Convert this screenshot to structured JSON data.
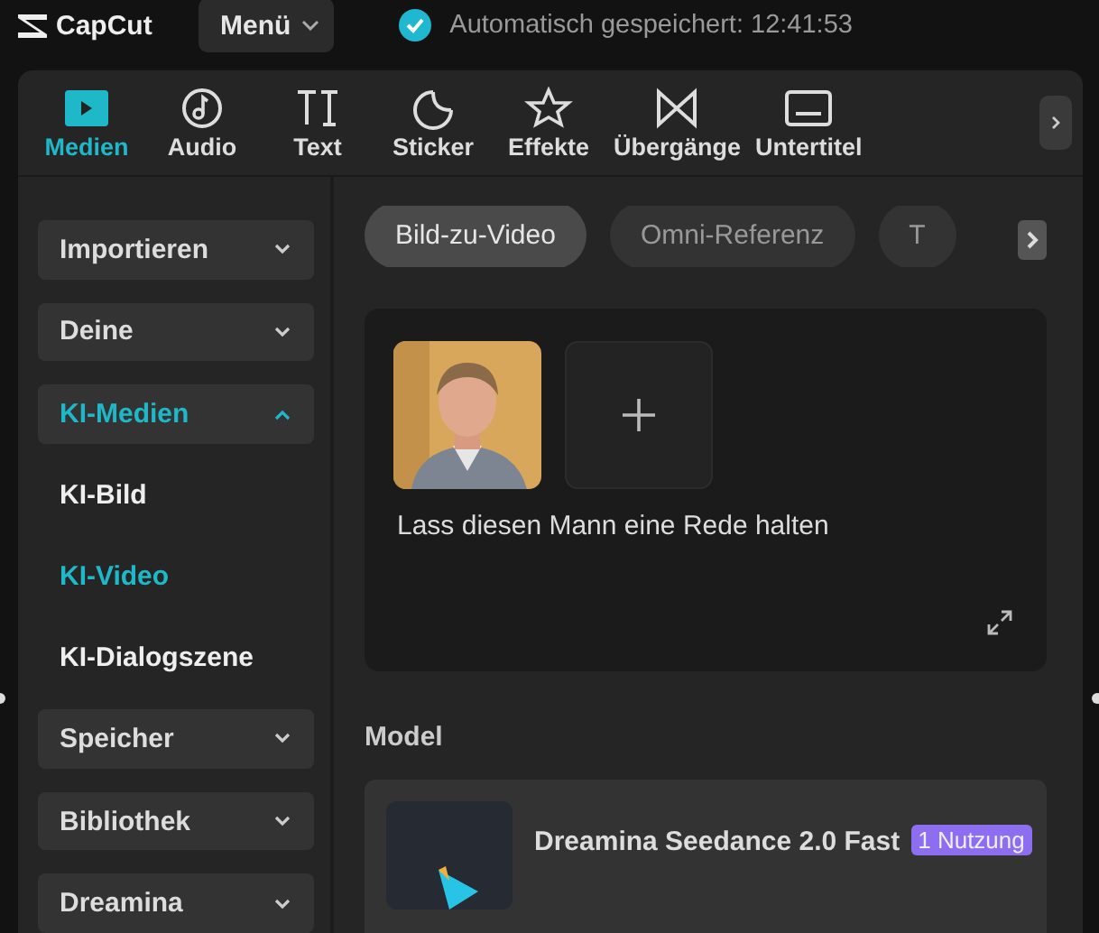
{
  "app": {
    "logo": "CapCut",
    "menu": "Menü",
    "autosave": "Automatisch gespeichert: 12:41:53"
  },
  "tabs": [
    {
      "label": "Medien",
      "kind": "media",
      "selected": true
    },
    {
      "label": "Audio",
      "kind": "audio",
      "selected": false
    },
    {
      "label": "Text",
      "kind": "text",
      "selected": false
    },
    {
      "label": "Sticker",
      "kind": "sticker",
      "selected": false
    },
    {
      "label": "Effekte",
      "kind": "effects",
      "selected": false
    },
    {
      "label": "Übergänge",
      "kind": "transitions",
      "selected": false
    },
    {
      "label": "Untertitel",
      "kind": "subtitles",
      "selected": false
    }
  ],
  "sidebar": [
    {
      "label": "Importieren",
      "kind": "group",
      "expanded": false,
      "selected": false
    },
    {
      "label": "Deine",
      "kind": "group",
      "expanded": false,
      "selected": false
    },
    {
      "label": "KI-Medien",
      "kind": "group",
      "expanded": true,
      "selected": true
    },
    {
      "label": "KI-Bild",
      "kind": "item",
      "selected": false
    },
    {
      "label": "KI-Video",
      "kind": "item",
      "selected": true
    },
    {
      "label": "KI-Dialogszene",
      "kind": "item",
      "selected": false
    },
    {
      "label": "Speicher",
      "kind": "group",
      "expanded": false,
      "selected": false
    },
    {
      "label": "Bibliothek",
      "kind": "group",
      "expanded": false,
      "selected": false
    },
    {
      "label": "Dreamina",
      "kind": "group",
      "expanded": false,
      "selected": false
    }
  ],
  "modes": [
    {
      "label": "Bild-zu-Video",
      "selected": true
    },
    {
      "label": "Omni-Referenz",
      "selected": false
    },
    {
      "label": "T",
      "selected": false
    }
  ],
  "prompt": {
    "value": "Lass diesen Mann eine Rede halten"
  },
  "model": {
    "heading": "Model",
    "name": "Dreamina Seedance 2.0 Fast",
    "badge": "1 Nutzung"
  }
}
